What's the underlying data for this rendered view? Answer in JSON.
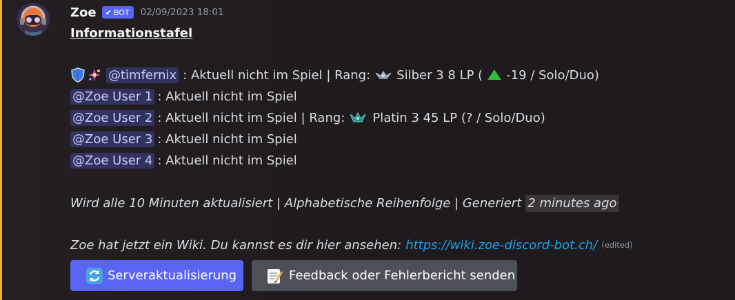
{
  "author": {
    "name": "Zoe",
    "bot_tag": "BOT",
    "timestamp": "02/09/2023 18:01"
  },
  "message": {
    "title": "Informationstafel",
    "lines": [
      {
        "mention": "@timfernix",
        "status": ": Aktuell nicht im Spiel | Rang:",
        "rank_icon": "silver-rank-icon",
        "rank": "Silber 3 8 LP (",
        "trend_icon": "green-up-triangle-icon",
        "change": "-19 / Solo/Duo)"
      },
      {
        "mention": "@Zoe User 1",
        "status": ": Aktuell nicht im Spiel"
      },
      {
        "mention": "@Zoe User 2",
        "status": ": Aktuell nicht im Spiel | Rang:",
        "rank_icon": "platinum-rank-icon",
        "rank": "Platin 3 45 LP (? / Solo/Duo)"
      },
      {
        "mention": "@Zoe User 3",
        "status": ": Aktuell nicht im Spiel"
      },
      {
        "mention": "@Zoe User 4",
        "status": ": Aktuell nicht im Spiel"
      }
    ],
    "footer_note": "Wird alle 10 Minuten aktualisiert | Alphabetische Reihenfolge | Generiert",
    "generated_ago": "2 minutes ago",
    "wiki_text": "Zoe hat jetzt ein Wiki. Du kannst es dir hier ansehen:",
    "wiki_link": "https://wiki.zoe-discord-bot.ch/",
    "edited_label": "(edited)"
  },
  "buttons": {
    "refresh_label": "Serveraktualisierung",
    "feedback_label": "Feedback oder Fehlerbericht senden"
  },
  "colors": {
    "accent": "#f0b232",
    "blurple": "#5865f2",
    "link": "#1fa3f0"
  }
}
